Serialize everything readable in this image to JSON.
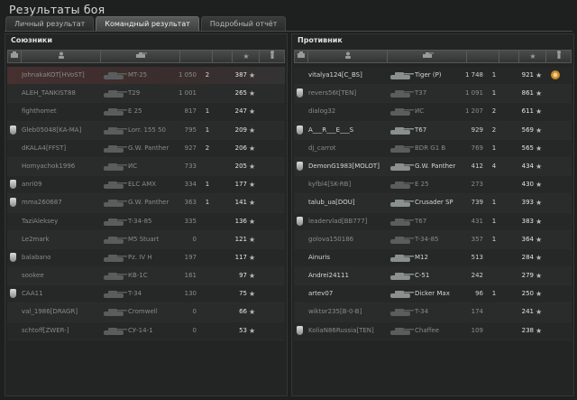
{
  "window": {
    "title": "Результаты боя"
  },
  "tabs": [
    {
      "label": "Личный результат",
      "active": false
    },
    {
      "label": "Командный результат",
      "active": true
    },
    {
      "label": "Подробный отчёт",
      "active": false
    }
  ],
  "allies": {
    "title": "Союзники",
    "rows": [
      {
        "player": "JohnakaKOT[HVoST]",
        "tank": "MT-25",
        "damage": "1 050",
        "kills": "2",
        "xp": "387",
        "clan": false,
        "dead": true,
        "me": true
      },
      {
        "player": "ALEH_TANKIST88",
        "tank": "T29",
        "damage": "1 001",
        "kills": "",
        "xp": "265",
        "clan": false,
        "dead": true
      },
      {
        "player": "fighthomet",
        "tank": "E 25",
        "damage": "817",
        "kills": "1",
        "xp": "247",
        "clan": false,
        "dead": true
      },
      {
        "player": "Gleb05048[KA-MA]",
        "tank": "Lorr. 155 50",
        "damage": "795",
        "kills": "1",
        "xp": "209",
        "clan": true,
        "dead": true
      },
      {
        "player": "dKALA4[FFST]",
        "tank": "G.W. Panther",
        "damage": "927",
        "kills": "2",
        "xp": "206",
        "clan": false,
        "dead": true
      },
      {
        "player": "Homyachok1996",
        "tank": "ИС",
        "damage": "733",
        "kills": "",
        "xp": "205",
        "clan": false,
        "dead": true
      },
      {
        "player": "anri09",
        "tank": "ELC AMX",
        "damage": "334",
        "kills": "1",
        "xp": "177",
        "clan": true,
        "dead": true
      },
      {
        "player": "mma260687",
        "tank": "G.W. Panther",
        "damage": "363",
        "kills": "1",
        "xp": "141",
        "clan": true,
        "dead": true
      },
      {
        "player": "TaziAleksey",
        "tank": "T-34-85",
        "damage": "335",
        "kills": "",
        "xp": "136",
        "clan": false,
        "dead": true
      },
      {
        "player": "Le2mark",
        "tank": "M5 Stuart",
        "damage": "0",
        "kills": "",
        "xp": "121",
        "clan": false,
        "dead": true
      },
      {
        "player": "balabano",
        "tank": "Pz. IV H",
        "damage": "197",
        "kills": "",
        "xp": "117",
        "clan": true,
        "dead": true
      },
      {
        "player": "sookee",
        "tank": "КВ-1С",
        "damage": "161",
        "kills": "",
        "xp": "97",
        "clan": false,
        "dead": true
      },
      {
        "player": "CAA11",
        "tank": "T-34",
        "damage": "130",
        "kills": "",
        "xp": "75",
        "clan": true,
        "dead": true
      },
      {
        "player": "val_1986[DRAGR]",
        "tank": "Cromwell",
        "damage": "0",
        "kills": "",
        "xp": "66",
        "clan": false,
        "dead": true
      },
      {
        "player": "schtoff[ZWER-]",
        "tank": "СУ-14-1",
        "damage": "0",
        "kills": "",
        "xp": "53",
        "clan": false,
        "dead": true
      }
    ]
  },
  "enemies": {
    "title": "Противник",
    "rows": [
      {
        "player": "vitalya124[C_BS]",
        "tank": "Tiger (P)",
        "damage": "1 748",
        "kills": "1",
        "xp": "921",
        "clan": false,
        "dead": false,
        "medal": true
      },
      {
        "player": "revers56t[TEN]",
        "tank": "T37",
        "damage": "1 091",
        "kills": "1",
        "xp": "861",
        "clan": true,
        "dead": true
      },
      {
        "player": "dialog32",
        "tank": "ИС",
        "damage": "1 207",
        "kills": "2",
        "xp": "611",
        "clan": false,
        "dead": true
      },
      {
        "player": "A___R___E___S",
        "tank": "T67",
        "damage": "929",
        "kills": "2",
        "xp": "569",
        "clan": true,
        "dead": false
      },
      {
        "player": "dj_carrot",
        "tank": "BDR G1 B",
        "damage": "769",
        "kills": "1",
        "xp": "565",
        "clan": false,
        "dead": true
      },
      {
        "player": "DemonG1983[MOLOT]",
        "tank": "G.W. Panther",
        "damage": "412",
        "kills": "4",
        "xp": "434",
        "clan": true,
        "dead": false
      },
      {
        "player": "kyfbl4[SK-RB]",
        "tank": "E 25",
        "damage": "273",
        "kills": "",
        "xp": "430",
        "clan": false,
        "dead": true
      },
      {
        "player": "talub_ua[DOU]",
        "tank": "Crusader SP",
        "damage": "739",
        "kills": "1",
        "xp": "393",
        "clan": false,
        "dead": false
      },
      {
        "player": "leadervlad[BB777]",
        "tank": "T67",
        "damage": "431",
        "kills": "1",
        "xp": "383",
        "clan": true,
        "dead": true
      },
      {
        "player": "golova150186",
        "tank": "T-34-85",
        "damage": "357",
        "kills": "1",
        "xp": "364",
        "clan": false,
        "dead": true
      },
      {
        "player": "Ainuris",
        "tank": "M12",
        "damage": "513",
        "kills": "",
        "xp": "284",
        "clan": false,
        "dead": false
      },
      {
        "player": "Andrei24111",
        "tank": "C-51",
        "damage": "242",
        "kills": "",
        "xp": "279",
        "clan": false,
        "dead": false
      },
      {
        "player": "artev07",
        "tank": "Dicker Max",
        "damage": "96",
        "kills": "1",
        "xp": "250",
        "clan": false,
        "dead": false
      },
      {
        "player": "wiktor235[B-0-B]",
        "tank": "T-34",
        "damage": "174",
        "kills": "",
        "xp": "241",
        "clan": false,
        "dead": true
      },
      {
        "player": "KoliaN86Russia[TEN]",
        "tank": "Chaffee",
        "damage": "109",
        "kills": "",
        "xp": "238",
        "clan": true,
        "dead": true
      }
    ]
  },
  "icons": {
    "star": "star-icon",
    "player": "player-icon",
    "tank": "tank-icon",
    "clan": "clan-emblem-icon",
    "medal": "medal-icon",
    "squad": "squad-icon",
    "status": "status-icon"
  },
  "colors": {
    "accent": "#e0e0e0",
    "self_row": "#463030",
    "dead_text": "#8a8a8a"
  }
}
